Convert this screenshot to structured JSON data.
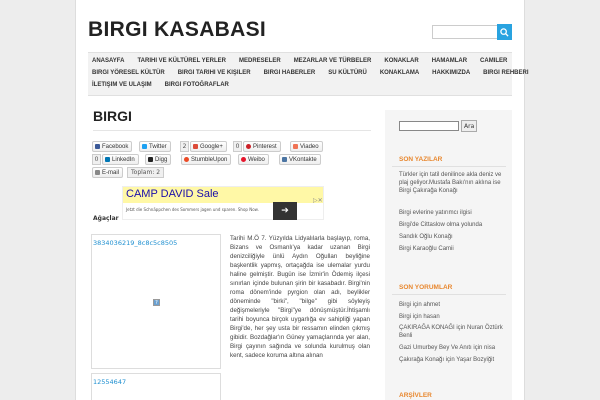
{
  "site": {
    "title": "BIRGI KASABASI"
  },
  "nav": {
    "row1": [
      "ANASAYFA",
      "TARIHI VE KÜLTÜREL YERLER",
      "MEDRESELER",
      "MEZARLAR VE TÜRBELER",
      "KONAKLAR",
      "HAMAMLAR",
      "CAMILER"
    ],
    "row2": [
      "BIRGI YÖRESEL KÜLTÜR",
      "BIRGI TARIHI VE KIŞILER",
      "BIRGI HABERLER",
      "SU KÜLTÜRÜ",
      "KONAKLAMA",
      "HAKKIMIZDA",
      "BIRGI REHBERI"
    ],
    "row3": [
      "İLETIŞIM VE ULAŞIM",
      "BIRGI FOTOĞRAFLAR"
    ]
  },
  "post": {
    "title": "BIRGI"
  },
  "share": {
    "facebook": "Facebook",
    "twitter": "Twitter",
    "google_count": "2",
    "google": "Google+",
    "pinterest_count": "0",
    "pinterest": "Pinterest",
    "viadeo": "Viadeo",
    "linkedin_count": "0",
    "linkedin": "LinkedIn",
    "digg": "Digg",
    "stumble": "StumbleUpon",
    "weibo": "Weibo",
    "vk": "VKontakte",
    "email": "E-mail",
    "toplam": "Toplam: 2"
  },
  "ad": {
    "title": "CAMP DAVID Sale",
    "subtitle": "Jetzt die Schnäppchen des Sommers jagen und sparen. Shop Now.",
    "arrow": "➔",
    "close": "▷✕"
  },
  "gallery": {
    "title": "Ağaçlar",
    "link1": "3834036219_8c8c5c8505",
    "link2": "12554647",
    "qmark": "?"
  },
  "article": {
    "text": "Tarihi M.Ö 7. Yüzyılda Lidyalılarla başlayıp, roma, Bizans ve Osmanlı'ya kadar uzanan Birgi denizciliğiyle ünlü Aydın Oğulları beyliğine başkentlik yapmış, ortaçağda ise ulemalar yurdu haline gelmiştir. Bugün ise İzmir'in Ödemiş ilçesi sınırları içinde bulunan şirin bir kasabadır. Birgi'nin roma dönem'inde pyrgion olan adı, beylikler döneminde \"birki\", \"bilge\" gibi söyleyiş değişmeleriyle \"Birgi\"ye dönüşmüştür.İhtişamlı tarihi boyunca birçok uygarlığa ev sahipliği yapan Birgi'de, her şey usta bir ressamın elinden çıkmış gibidir. Bozdağlar'ın Güney yamaçlarında yer alan, Birgi çayının sağında ve solunda kurulmuş olan kent, sadece koruma altına alınan"
  },
  "sidebar": {
    "search_button": "Ara",
    "recent_title": "SON YAZILAR",
    "recent": [
      "Türkler için tatil denilince akla deniz ve plaj geliyor.Mustafa Bakı'nın aklına ise Birgi Çakırağa Konağı",
      "Birgi evlerine yatırımcı ilgisi",
      "Birgi'de Cittaslow olma yolunda",
      "Sandık Oğlu Konağı",
      "Birgi Karaoğlu Camii"
    ],
    "comments_title": "SON YORUMLAR",
    "comments": [
      "Birgi için ahmet",
      "Birgi için hasan",
      "ÇAKIRAĞA KONAĞI için Nuran Öztürk Benli",
      "Gazi Umurbey Bey Ve Anıtı için nisa",
      "Çakırağa Konağı için Yaşar Bozyiğit"
    ],
    "archive_title": "ARŞİVLER"
  }
}
